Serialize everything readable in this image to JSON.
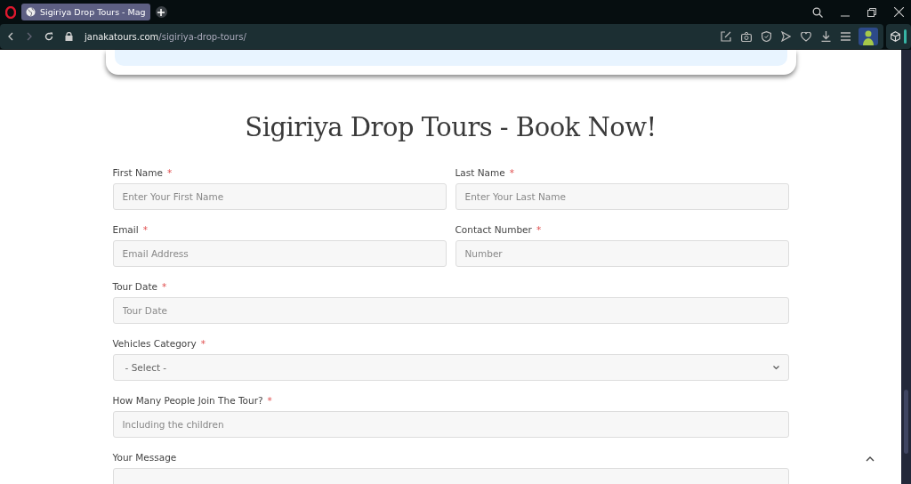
{
  "browser": {
    "tab_title": "Sigiriya Drop Tours - Mag",
    "selected": true,
    "url_host": "janakatours.com",
    "url_path": "/sigiriya-drop-tours/"
  },
  "heading": "Sigiriya Drop Tours - Book Now!",
  "form_rows": [
    [
      {
        "kind": "text",
        "label": "First Name",
        "required_mark": "*",
        "placeholder": "Enter Your First Name"
      },
      {
        "kind": "text",
        "label": "Last Name",
        "required_mark": "*",
        "placeholder": "Enter Your Last Name"
      }
    ],
    [
      {
        "kind": "text",
        "label": "Email",
        "required_mark": "*",
        "placeholder": "Email Address"
      },
      {
        "kind": "text",
        "label": "Contact Number",
        "required_mark": "*",
        "placeholder": "Number"
      }
    ],
    [
      {
        "kind": "text",
        "label": "Tour Date",
        "required_mark": "*",
        "placeholder": "Tour Date"
      }
    ],
    [
      {
        "kind": "select",
        "label": "Vehicles Category",
        "required_mark": "*",
        "value": "- Select -"
      }
    ],
    [
      {
        "kind": "text",
        "label": "How Many People Join The Tour?",
        "required_mark": "*",
        "placeholder": "Including the children"
      }
    ],
    [
      {
        "kind": "textarea",
        "label": "Your Message"
      }
    ]
  ]
}
